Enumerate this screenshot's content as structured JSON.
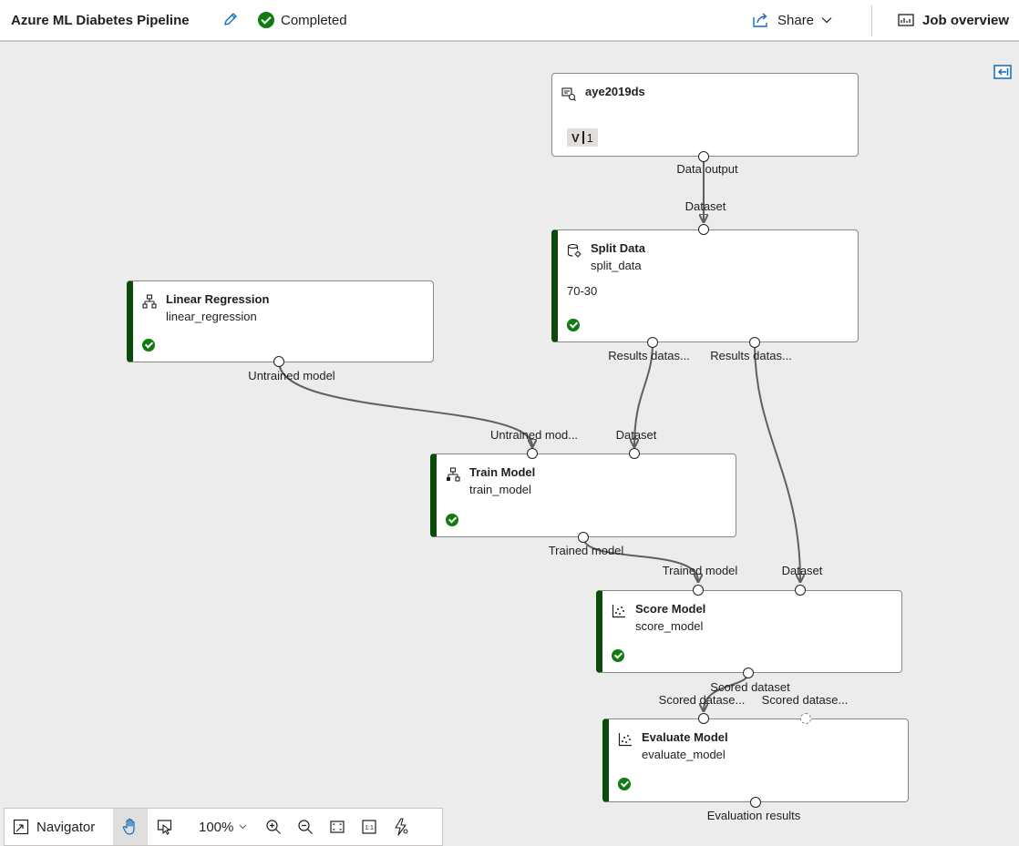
{
  "header": {
    "title": "Azure ML Diabetes Pipeline",
    "status": "Completed",
    "share_label": "Share",
    "job_overview_label": "Job overview"
  },
  "nodes": {
    "dataset": {
      "title": "aye2019ds",
      "version_prefix": "V",
      "version_number": "1",
      "output_label": "Data output"
    },
    "split": {
      "title": "Split Data",
      "subtitle": "split_data",
      "param": "70-30",
      "input_label": "Dataset",
      "output1_label": "Results datas...",
      "output2_label": "Results datas..."
    },
    "linear": {
      "title": "Linear Regression",
      "subtitle": "linear_regression",
      "output_label": "Untrained model"
    },
    "train": {
      "title": "Train Model",
      "subtitle": "train_model",
      "input1_label": "Untrained mod...",
      "input2_label": "Dataset",
      "output_label": "Trained model"
    },
    "score": {
      "title": "Score Model",
      "subtitle": "score_model",
      "input1_label": "Trained model",
      "input2_label": "Dataset",
      "output_label": "Scored dataset"
    },
    "evaluate": {
      "title": "Evaluate Model",
      "subtitle": "evaluate_model",
      "input1_label": "Scored datase...",
      "input2_label": "Scored datase...",
      "output_label": "Evaluation results"
    }
  },
  "toolbar": {
    "navigator_label": "Navigator",
    "zoom_level": "100%"
  },
  "colors": {
    "completed": "#107c10",
    "node_status_bar": "#0b4a0b",
    "canvas": "#ececec",
    "edge": "#5f5f5f"
  }
}
